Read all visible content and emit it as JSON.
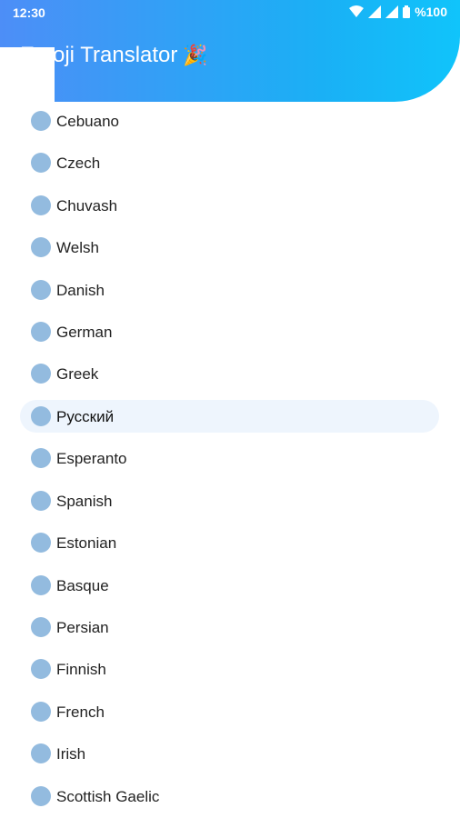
{
  "status_bar": {
    "time": "12:30",
    "battery": "%100",
    "icons": [
      "wifi-icon",
      "signal-icon",
      "signal-icon",
      "battery-icon"
    ]
  },
  "header": {
    "title": "Emoji Translator",
    "title_icon": "🎉",
    "gradient_start": "#4d8ef7",
    "gradient_end": "#10c4fb"
  },
  "languages": {
    "selected_index": 7,
    "items": [
      "Cebuano",
      "Czech",
      "Chuvash",
      "Welsh",
      "Danish",
      "German",
      "Greek",
      "Русский",
      "Esperanto",
      "Spanish",
      "Estonian",
      "Basque",
      "Persian",
      "Finnish",
      "French",
      "Irish",
      "Scottish Gaelic"
    ]
  },
  "colors": {
    "radio": "#93bbdf",
    "selected_background": "#eef5fd"
  }
}
